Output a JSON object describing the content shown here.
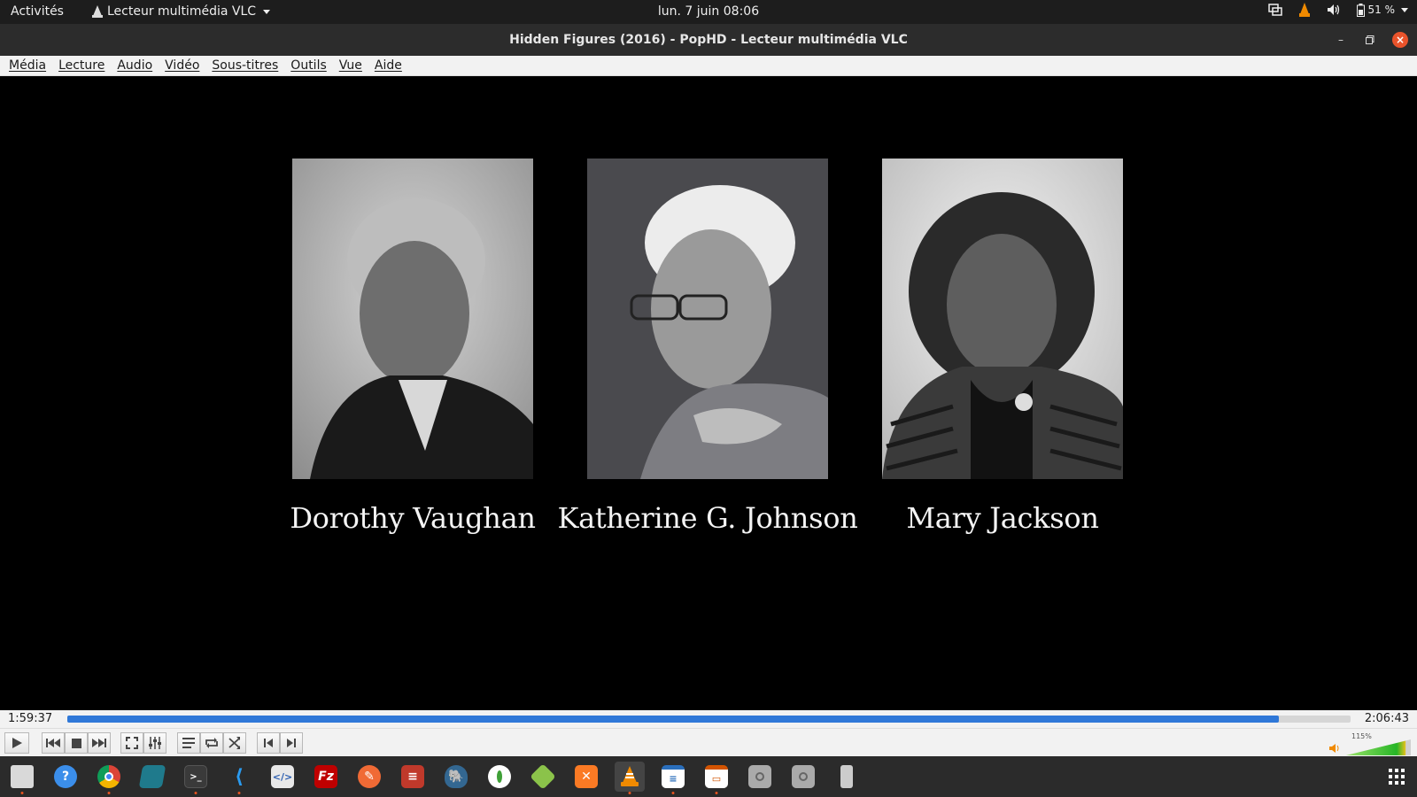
{
  "system_bar": {
    "activities": "Activités",
    "app_menu": "Lecteur multimédia VLC",
    "clock": "lun. 7 juin  08:06",
    "battery": "51 %"
  },
  "window": {
    "title": "Hidden Figures (2016) - PopHD - Lecteur multimédia VLC"
  },
  "menu": [
    "Média",
    "Lecture",
    "Audio",
    "Vidéo",
    "Sous-titres",
    "Outils",
    "Vue",
    "Aide"
  ],
  "video": {
    "people": [
      {
        "name": "Dorothy Vaughan"
      },
      {
        "name": "Katherine G. Johnson"
      },
      {
        "name": "Mary Jackson"
      }
    ]
  },
  "player": {
    "elapsed": "1:59:37",
    "total": "2:06:43",
    "progress_fraction": 0.944,
    "volume_label": "115%",
    "volume_fraction": 0.92
  },
  "dock": {
    "icons": [
      "files-icon",
      "help-icon",
      "chrome-icon",
      "anydesk-icon",
      "terminal-icon",
      "vscode-icon",
      "code-editor-icon",
      "filezilla-icon",
      "postman-icon",
      "archive-icon",
      "postgres-icon",
      "mongodb-icon",
      "3d-box-icon",
      "xampp-icon",
      "vlc-icon",
      "writer-icon",
      "impress-icon",
      "disk-icon",
      "disk2-icon",
      "usb-icon"
    ]
  },
  "colors": {
    "accent": "#2f78d8",
    "close_button": "#e9532b",
    "vlc_orange": "#f08a00"
  }
}
